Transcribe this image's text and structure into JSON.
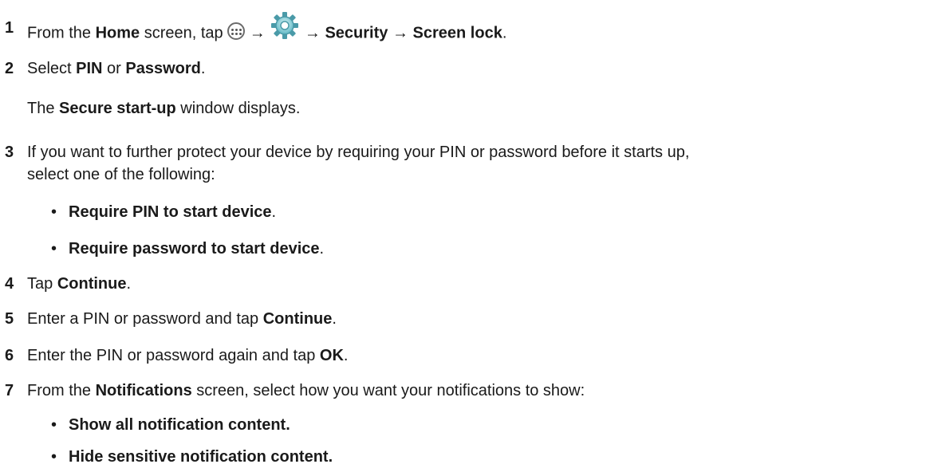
{
  "arrow": "→",
  "bullet_char": "•",
  "steps": [
    {
      "num": "1",
      "pre": "From the ",
      "home": "Home",
      "mid": " screen, tap ",
      "security": "Security",
      "screen_lock": "Screen lock",
      "end": ".",
      "icons": [
        "apps-icon",
        "gear-icon"
      ]
    },
    {
      "num": "2",
      "pre": "Select ",
      "pin": "PIN",
      "or": " or ",
      "password": "Password",
      "end": ".",
      "note_pre": "The ",
      "note_bold": "Secure start-up",
      "note_post": " window displays."
    },
    {
      "num": "3",
      "line1": "If you want to further protect your device by requiring your PIN or password before it starts up,",
      "line2": "select one of the following:",
      "options": [
        {
          "label": "Require PIN to start device",
          "end": "."
        },
        {
          "label": "Require password to start device",
          "end": "."
        }
      ]
    },
    {
      "num": "4",
      "pre": "Tap ",
      "bold": "Continue",
      "end": "."
    },
    {
      "num": "5",
      "pre": "Enter a PIN or password and tap ",
      "bold": "Continue",
      "end": "."
    },
    {
      "num": "6",
      "pre": "Enter the PIN or password again and tap ",
      "bold": "OK",
      "end": "."
    },
    {
      "num": "7",
      "pre": "From the ",
      "bold": "Notifications",
      "post": " screen, select how you want your notifications to show:",
      "options": [
        {
          "label": "Show all notification content."
        },
        {
          "label": "Hide sensitive notification content."
        }
      ]
    }
  ]
}
